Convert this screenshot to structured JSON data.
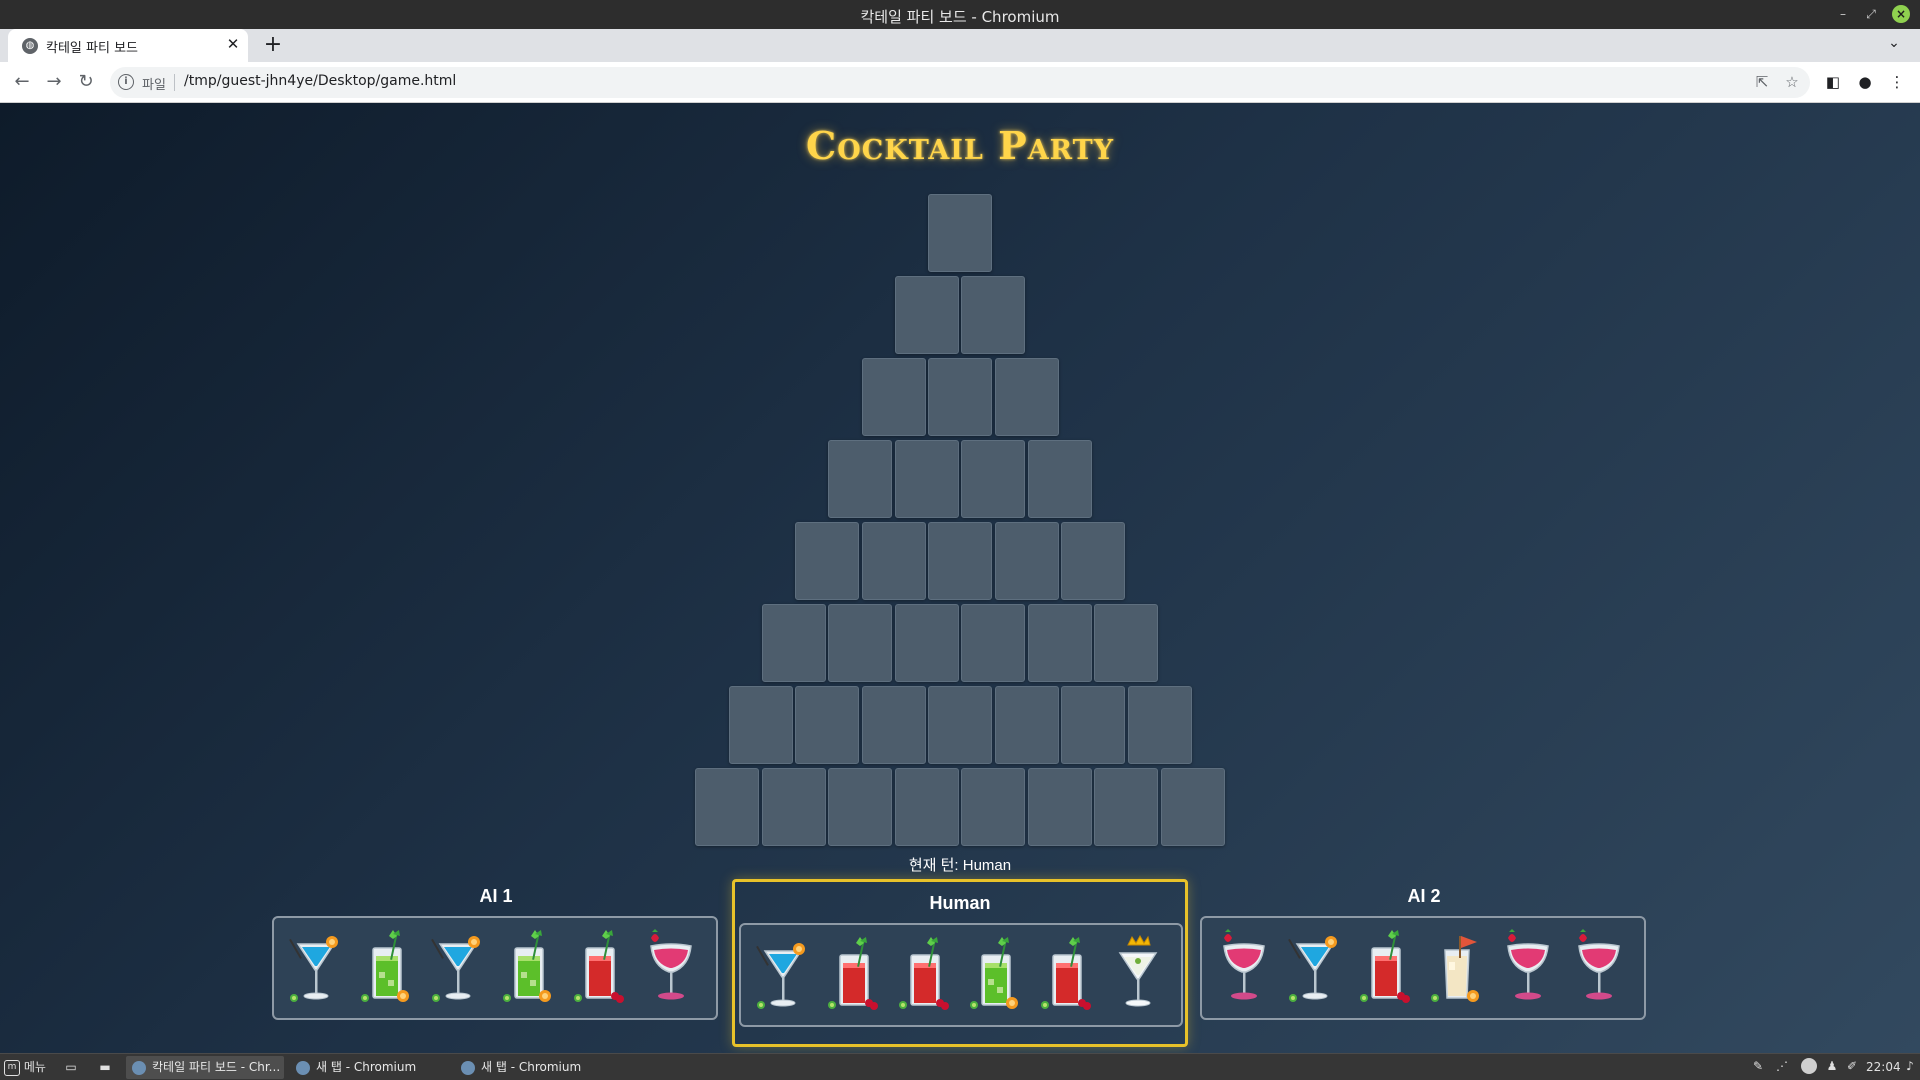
{
  "window": {
    "title": "칵테일 파티 보드 - Chromium"
  },
  "browser": {
    "tab_title": "칵테일 파티 보드",
    "scheme_label": "파일",
    "url": "/tmp/guest-jhn4ye/Desktop/game.html"
  },
  "game": {
    "title": "Cocktail Party",
    "pyramid_rows": [
      1,
      2,
      3,
      4,
      5,
      6,
      7,
      8
    ],
    "turn_label": "현재 턴: Human",
    "players": [
      {
        "name": "AI 1",
        "active": false,
        "drinks": [
          "blue-martini",
          "green-mojito",
          "blue-martini",
          "green-mojito",
          "red-highball",
          "pink-cosmo"
        ]
      },
      {
        "name": "Human",
        "active": true,
        "drinks": [
          "blue-martini",
          "red-highball",
          "red-highball",
          "green-mojito",
          "red-highball",
          "clear-martini"
        ]
      },
      {
        "name": "AI 2",
        "active": false,
        "drinks": [
          "pink-cosmo",
          "blue-martini",
          "red-highball",
          "cream-pina",
          "pink-cosmo",
          "pink-cosmo"
        ]
      }
    ]
  },
  "colors": {
    "title_gold": "#ffd54a",
    "card_slot": "#4d5d6c",
    "active_border": "#e8c22a"
  },
  "taskbar": {
    "menu_label": "메뉴",
    "windows": [
      "칵테일 파티 보드 - Chr...",
      "새 탭 - Chromium",
      "새 탭 - Chromium"
    ],
    "clock": "22:04"
  }
}
